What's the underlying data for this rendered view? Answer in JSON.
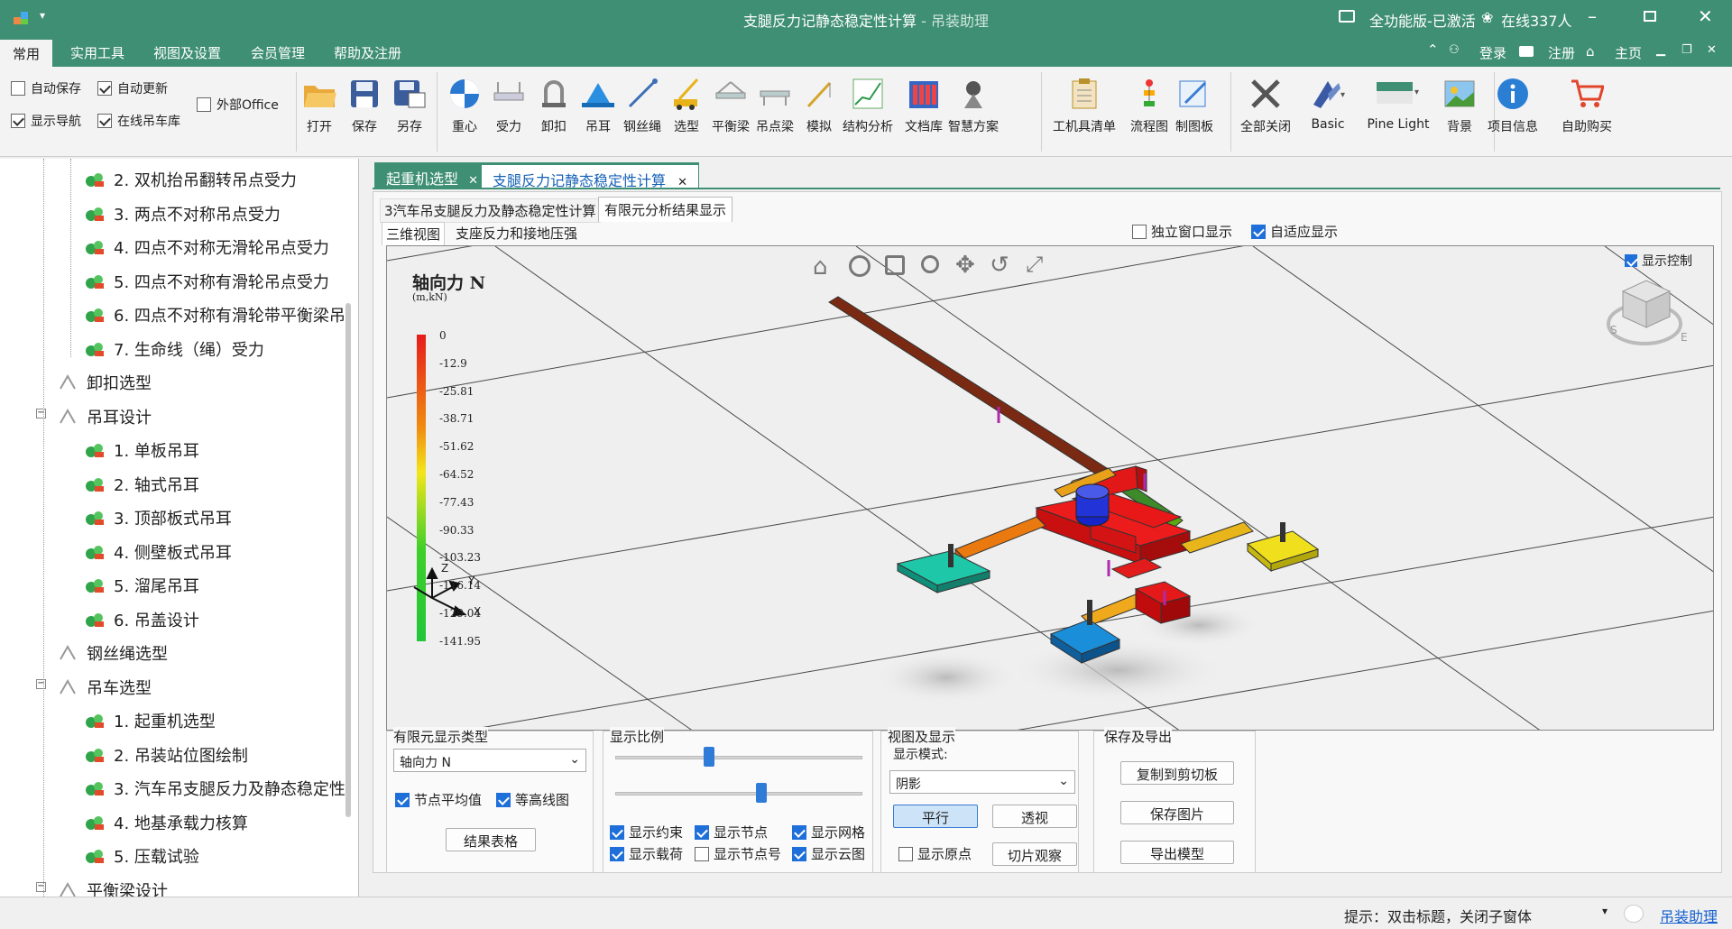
{
  "titlebar": {
    "title": "支腿反力记静态稳定性计算",
    "app_name": "- 吊装助理",
    "edition": "全功能版-已激活",
    "online": "在线337人"
  },
  "menu": {
    "items": [
      "常用",
      "实用工具",
      "视图及设置",
      "会员管理",
      "帮助及注册"
    ],
    "right": {
      "login": "登录",
      "register": "注册",
      "home": "主页"
    }
  },
  "ribbon": {
    "checks": [
      {
        "label": "自动保存",
        "checked": false
      },
      {
        "label": "自动更新",
        "checked": true
      },
      {
        "label": "外部Office",
        "checked": false
      },
      {
        "label": "显示导航",
        "checked": true
      },
      {
        "label": "在线吊车库",
        "checked": true
      }
    ],
    "file_buttons": [
      "打开",
      "保存",
      "另存"
    ],
    "calc_buttons": [
      "重心",
      "受力",
      "卸扣",
      "吊耳",
      "钢丝绳",
      "选型",
      "平衡梁",
      "吊点梁",
      "模拟",
      "结构分析",
      "文档库",
      "智慧方案"
    ],
    "tool_buttons": [
      "工机具清单",
      "流程图",
      "制图板"
    ],
    "view_buttons": [
      "全部关闭",
      "Basic",
      "Pine Light",
      "背景"
    ],
    "info_buttons": [
      "项目信息",
      "自助购买"
    ]
  },
  "tree": {
    "items": [
      {
        "label": "2. 双机抬吊翻转吊点受力",
        "level": 2
      },
      {
        "label": "3. 两点不对称吊点受力",
        "level": 2
      },
      {
        "label": "4. 四点不对称无滑轮吊点受力",
        "level": 2
      },
      {
        "label": "5. 四点不对称有滑轮吊点受力",
        "level": 2
      },
      {
        "label": "6. 四点不对称有滑轮带平衡梁吊",
        "level": 2
      },
      {
        "label": "7. 生命线（绳）受力",
        "level": 2
      },
      {
        "label": "卸扣选型",
        "level": 1
      },
      {
        "label": "吊耳设计",
        "level": 1
      },
      {
        "label": "1. 单板吊耳",
        "level": 2
      },
      {
        "label": "2. 轴式吊耳",
        "level": 2
      },
      {
        "label": "3. 顶部板式吊耳",
        "level": 2
      },
      {
        "label": "4. 侧壁板式吊耳",
        "level": 2
      },
      {
        "label": "5. 溜尾吊耳",
        "level": 2
      },
      {
        "label": "6. 吊盖设计",
        "level": 2
      },
      {
        "label": "钢丝绳选型",
        "level": 1
      },
      {
        "label": "吊车选型",
        "level": 1
      },
      {
        "label": "1. 起重机选型",
        "level": 2
      },
      {
        "label": "2. 吊装站位图绘制",
        "level": 2
      },
      {
        "label": "3. 汽车吊支腿反力及静态稳定性",
        "level": 2
      },
      {
        "label": "4. 地基承载力核算",
        "level": 2
      },
      {
        "label": "5. 压载试验",
        "level": 2
      },
      {
        "label": "平衡梁设计",
        "level": 1
      }
    ]
  },
  "doc_tabs": [
    "起重机选型",
    "支腿反力记静态稳定性计算"
  ],
  "sub_tabs": [
    "3汽车吊支腿反力及静态稳定性计算",
    "有限元分析结果显示"
  ],
  "view_tabs": [
    "三维视图",
    "支座反力和接地压强"
  ],
  "view_options": {
    "independent_window": "独立窗口显示",
    "adaptive": "自适应显示",
    "show_control": "显示控制"
  },
  "legend": {
    "title": "轴向力 N",
    "units": "(m,kN)",
    "ticks": [
      "0",
      "-12.9",
      "-25.81",
      "-38.71",
      "-51.62",
      "-64.52",
      "-77.43",
      "-90.33",
      "-103.23",
      "-116.14",
      "-129.04",
      "-141.95"
    ]
  },
  "axes": {
    "z": "Z",
    "y": "Y",
    "x": "X"
  },
  "viewcube": {
    "s": "S",
    "e": "E"
  },
  "bottom": {
    "fem_group": {
      "title": "有限元显示类型",
      "select": "轴向力 N",
      "avg": "节点平均值",
      "contour": "等高线图",
      "table_btn": "结果表格"
    },
    "scale_group": {
      "title": "显示比例",
      "slider1": 0.38,
      "slider2": 0.59,
      "checks": [
        {
          "label": "显示约束",
          "checked": true
        },
        {
          "label": "显示节点",
          "checked": true
        },
        {
          "label": "显示网格",
          "checked": true
        },
        {
          "label": "显示载荷",
          "checked": true
        },
        {
          "label": "显示节点号",
          "checked": false
        },
        {
          "label": "显示云图",
          "checked": true
        }
      ]
    },
    "view_group": {
      "title": "视图及显示",
      "mode_label": "显示模式:",
      "mode": "阴影",
      "parallel": "平行",
      "perspective": "透视",
      "origin": "显示原点",
      "slice": "切片观察"
    },
    "export_group": {
      "title": "保存及导出",
      "copy": "复制到剪切板",
      "save_img": "保存图片",
      "export_model": "导出模型"
    }
  },
  "status": {
    "hint": "提示：双击标题，关闭子窗体",
    "link": "吊装助理"
  }
}
